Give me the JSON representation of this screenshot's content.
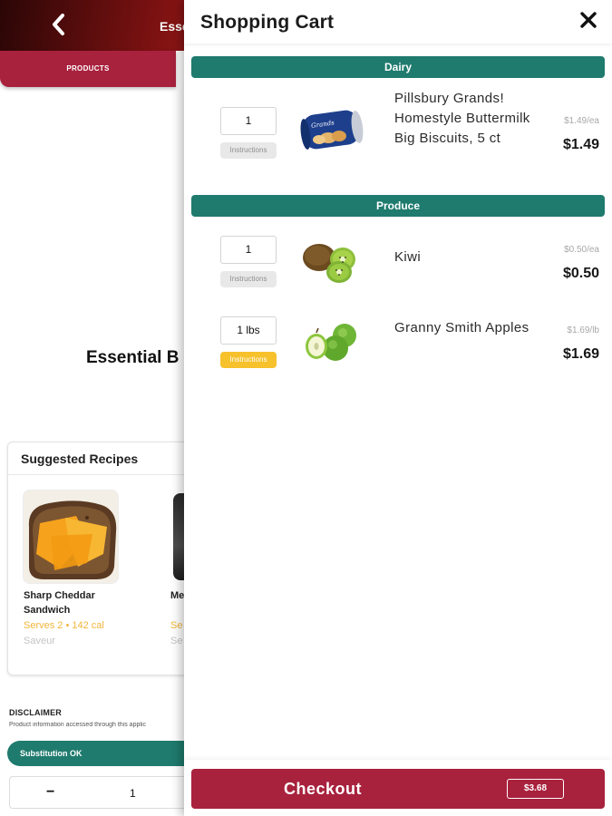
{
  "background": {
    "title": "Esse",
    "tabs": {
      "products": "PRODUCTS"
    },
    "recipe_title": "Essential B",
    "suggested": {
      "title": "Suggested Recipes",
      "recipes": [
        {
          "name": "Sharp Cheddar Sandwich",
          "meta": "Serves 2 • 142 cal",
          "source": "Saveur"
        },
        {
          "name": "Me Ch",
          "meta": "Se",
          "source": "Se"
        }
      ]
    },
    "disclaimer": {
      "heading": "DISCLAIMER",
      "text": "Product information accessed through this applic"
    },
    "substitution": "Substitution OK",
    "stepper": {
      "minus": "−",
      "value": "1"
    }
  },
  "cart": {
    "title": "Shopping Cart",
    "sections": [
      {
        "name": "Dairy",
        "items": [
          {
            "qty": "1",
            "instructions": "Instructions",
            "name": "Pillsbury Grands! Homestyle Buttermilk Big Biscuits, 5 ct",
            "unit_price": "$1.49/ea",
            "price": "$1.49"
          }
        ]
      },
      {
        "name": "Produce",
        "items": [
          {
            "qty": "1",
            "instructions": "Instructions",
            "name": "Kiwi",
            "unit_price": "$0.50/ea",
            "price": "$0.50"
          },
          {
            "qty": "1 lbs",
            "instructions": "Instructions",
            "name": "Granny Smith Apples",
            "unit_price": "$1.69/lb",
            "price": "$1.69"
          }
        ]
      }
    ],
    "checkout": {
      "label": "Checkout",
      "total": "$3.68"
    }
  },
  "colors": {
    "accent_red": "#a8213d",
    "section_teal": "#1f7b6e",
    "instructions_yellow": "#f6c12b"
  },
  "icons": {
    "back": "chevron-left-icon",
    "close": "close-icon"
  }
}
